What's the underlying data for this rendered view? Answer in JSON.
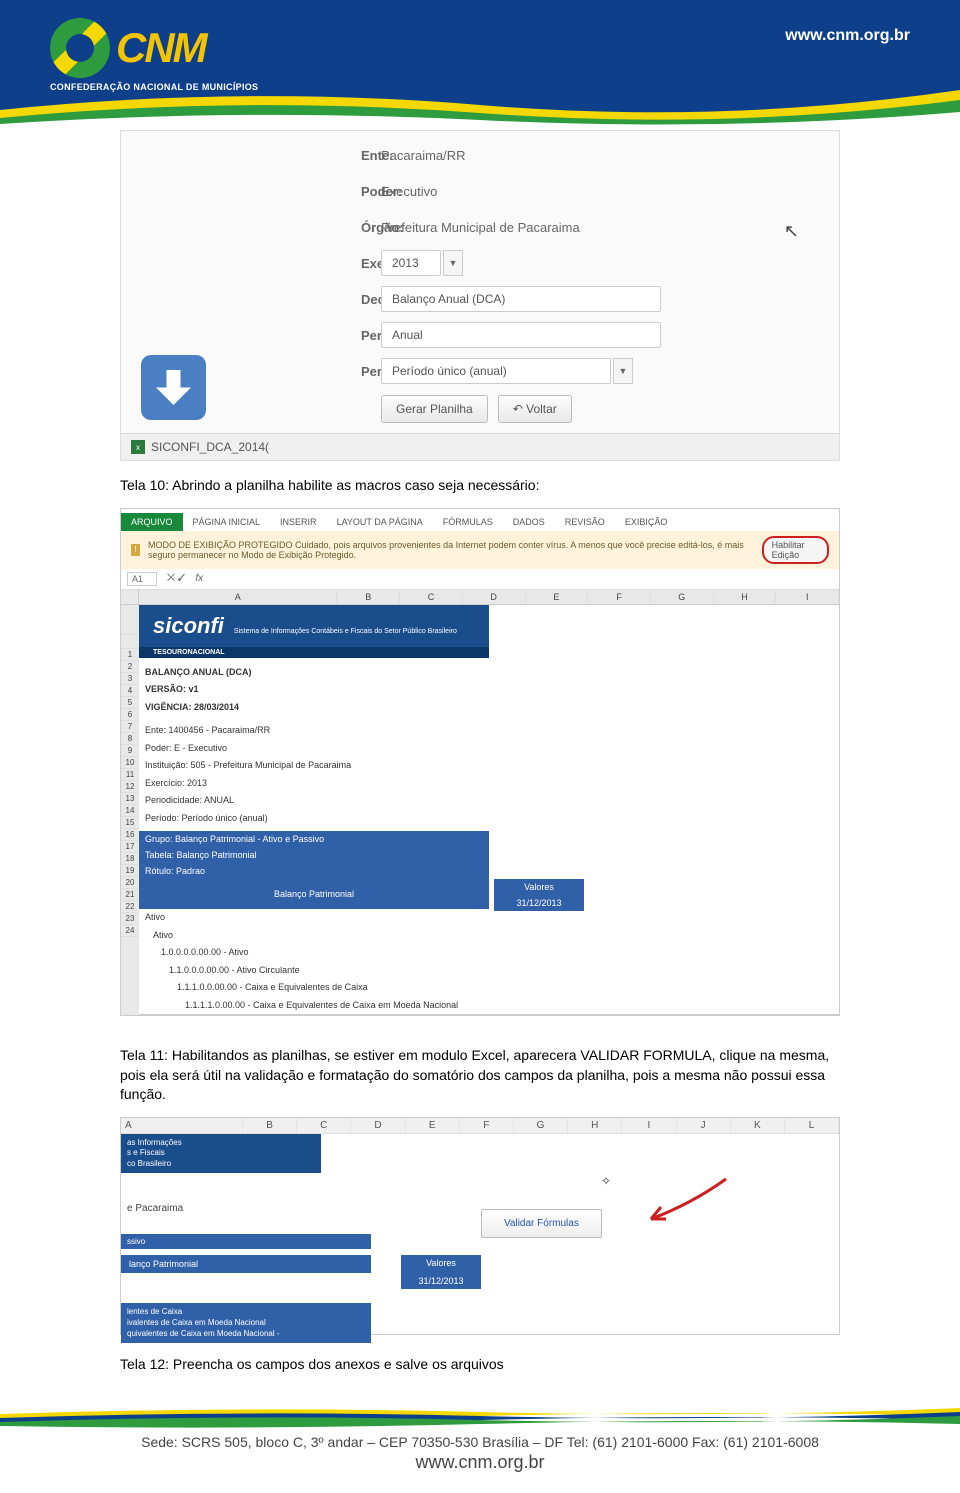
{
  "header": {
    "logo_text": "CNM",
    "logo_subtitle": "CONFEDERAÇÃO NACIONAL DE MUNICÍPIOS",
    "url": "www.cnm.org.br"
  },
  "screenshot1": {
    "form": {
      "ente_label": "Ente:",
      "ente_value": "Pacaraima/RR",
      "poder_label": "Poder:",
      "poder_value": "Executivo",
      "orgao_label": "Órgão:",
      "orgao_value": "Prefeitura Municipal de Pacaraima",
      "exercicio_label": "Exercício: *",
      "exercicio_value": "2013",
      "declaracao_label": "Declaração: *",
      "declaracao_value": "Balanço Anual (DCA)",
      "periodicidade_label": "Periodicidade: *",
      "periodicidade_value": "Anual",
      "periodo_label": "Período: *",
      "periodo_value": "Período único (anual)",
      "btn_gerar": "Gerar Planilha",
      "btn_voltar": "↶  Voltar"
    },
    "filename": "SICONFI_DCA_2014("
  },
  "caption1": "Tela 10: Abrindo a planilha habilite as macros caso seja necessário:",
  "screenshot2": {
    "ribbon": {
      "arquivo": "ARQUIVO",
      "pagina_inicial": "PÁGINA INICIAL",
      "inserir": "INSERIR",
      "layout": "LAYOUT DA PÁGINA",
      "formulas": "FÓRMULAS",
      "dados": "DADOS",
      "revisao": "REVISÃO",
      "exibicao": "EXIBIÇÃO"
    },
    "protected_msg": "MODO DE EXIBIÇÃO PROTEGIDO  Cuidado, pois arquivos provenientes da Internet podem conter vírus. A menos que você precise editá-los, é mais seguro permanecer no Modo de Exibição Protegido.",
    "habilitar_btn": "Habilitar Edição",
    "cell_ref": "A1",
    "cols": [
      "A",
      "B",
      "C",
      "D",
      "E",
      "F",
      "G",
      "H",
      "I"
    ],
    "siconfi": "siconfi",
    "siconfi_sub": "Sistema de Informações Contábeis e Fiscais do Setor Público Brasileiro",
    "tesouro": "TESOURONACIONAL",
    "balanco": "BALANÇO ANUAL (DCA)",
    "versao": "VERSÃO: v1",
    "vigencia": "VIGÊNCIA: 28/03/2014",
    "ente": "Ente: 1400456 - Pacaraima/RR",
    "poder": "Poder: E - Executivo",
    "instituicao": "Instituição: 505 - Prefeitura Municipal de Pacaraima",
    "exercicio": "Exercício: 2013",
    "periodicidade": "Periodicidade: ANUAL",
    "periodo": "Período: Período único (anual)",
    "grupo": "Grupo: Balanço Patrimonial - Ativo e Passivo",
    "tabela": "Tabela: Balanço Patrimonial",
    "rotulo": "Rótulo: Padrao",
    "balanco_patrimonial": "Balanço Patrimonial",
    "valores": "Valores",
    "data": "31/12/2013",
    "ativo1": "Ativo",
    "ativo2": "Ativo",
    "l1": "1.0.0.0.0.00.00 - Ativo",
    "l2": "1.1.0.0.0.00.00 - Ativo Circulante",
    "l3": "1.1.1.0.0.00.00 - Caixa e Equivalentes de Caixa",
    "l4": "1.1.1.1.0.00.00 - Caixa e Equivalentes de Caixa em Moeda Nacional"
  },
  "caption2": "Tela 11: Habilitandos as planilhas, se estiver em modulo Excel, aparecera VALIDAR FORMULA, clique na mesma, pois ela será útil na validação e formatação do somatório dos campos da planilha, pois a mesma não possui essa função.",
  "screenshot3": {
    "cols": [
      "A",
      "B",
      "C",
      "D",
      "E",
      "F",
      "G",
      "H",
      "I",
      "J",
      "K",
      "L"
    ],
    "blue_text1": "as Informações\ns e Fiscais\nco Brasileiro",
    "pacaraima": "e Pacaraima",
    "ssivo": "ssivo",
    "balanco": "lanço Patrimonial",
    "valores": "Valores",
    "data": "31/12/2013",
    "bottom1": "lentes de Caixa",
    "bottom2": "ivalentes de Caixa em Moeda Nacional",
    "bottom3": "quivalentes de Caixa em Moeda Nacional -",
    "validar_btn": "Validar Fórmulas"
  },
  "caption3": "Tela 12: Preencha os campos dos anexos e salve os arquivos",
  "footer": {
    "address": "Sede: SCRS 505, bloco C, 3º andar – CEP 70350-530  Brasília – DF  Tel: (61) 2101-6000 Fax: (61) 2101-6008",
    "url": "www.cnm.org.br"
  }
}
